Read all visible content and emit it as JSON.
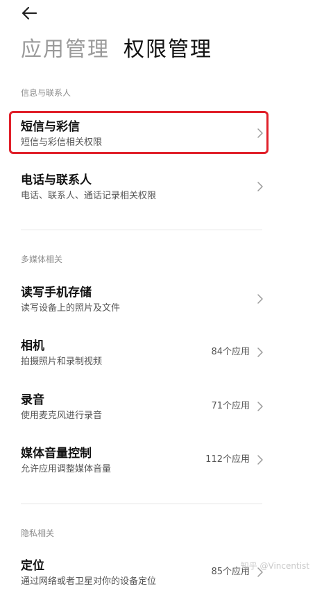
{
  "header": {
    "tab_inactive": "应用管理",
    "tab_active": "权限管理"
  },
  "sections": {
    "messaging": "信息与联系人",
    "media": "多媒体相关",
    "privacy": "隐私相关"
  },
  "items": {
    "sms": {
      "title": "短信与彩信",
      "subtitle": "短信与彩信相关权限"
    },
    "phone": {
      "title": "电话与联系人",
      "subtitle": "电话、联系人、通话记录相关权限"
    },
    "storage": {
      "title": "读写手机存储",
      "subtitle": "读写设备上的照片及文件"
    },
    "camera": {
      "title": "相机",
      "subtitle": "拍摄照片和录制视频",
      "count": "84个应用"
    },
    "record": {
      "title": "录音",
      "subtitle": "使用麦克风进行录音",
      "count": "71个应用"
    },
    "volume": {
      "title": "媒体音量控制",
      "subtitle": "允许应用调整媒体音量",
      "count": "112个应用"
    },
    "location": {
      "title": "定位",
      "subtitle": "通过网络或者卫星对你的设备定位",
      "count": "85个应用"
    }
  },
  "watermark": "知乎 @Vincentist",
  "colors": {
    "highlight": "#e0202a",
    "inactive_tab": "#9a9a9a"
  }
}
